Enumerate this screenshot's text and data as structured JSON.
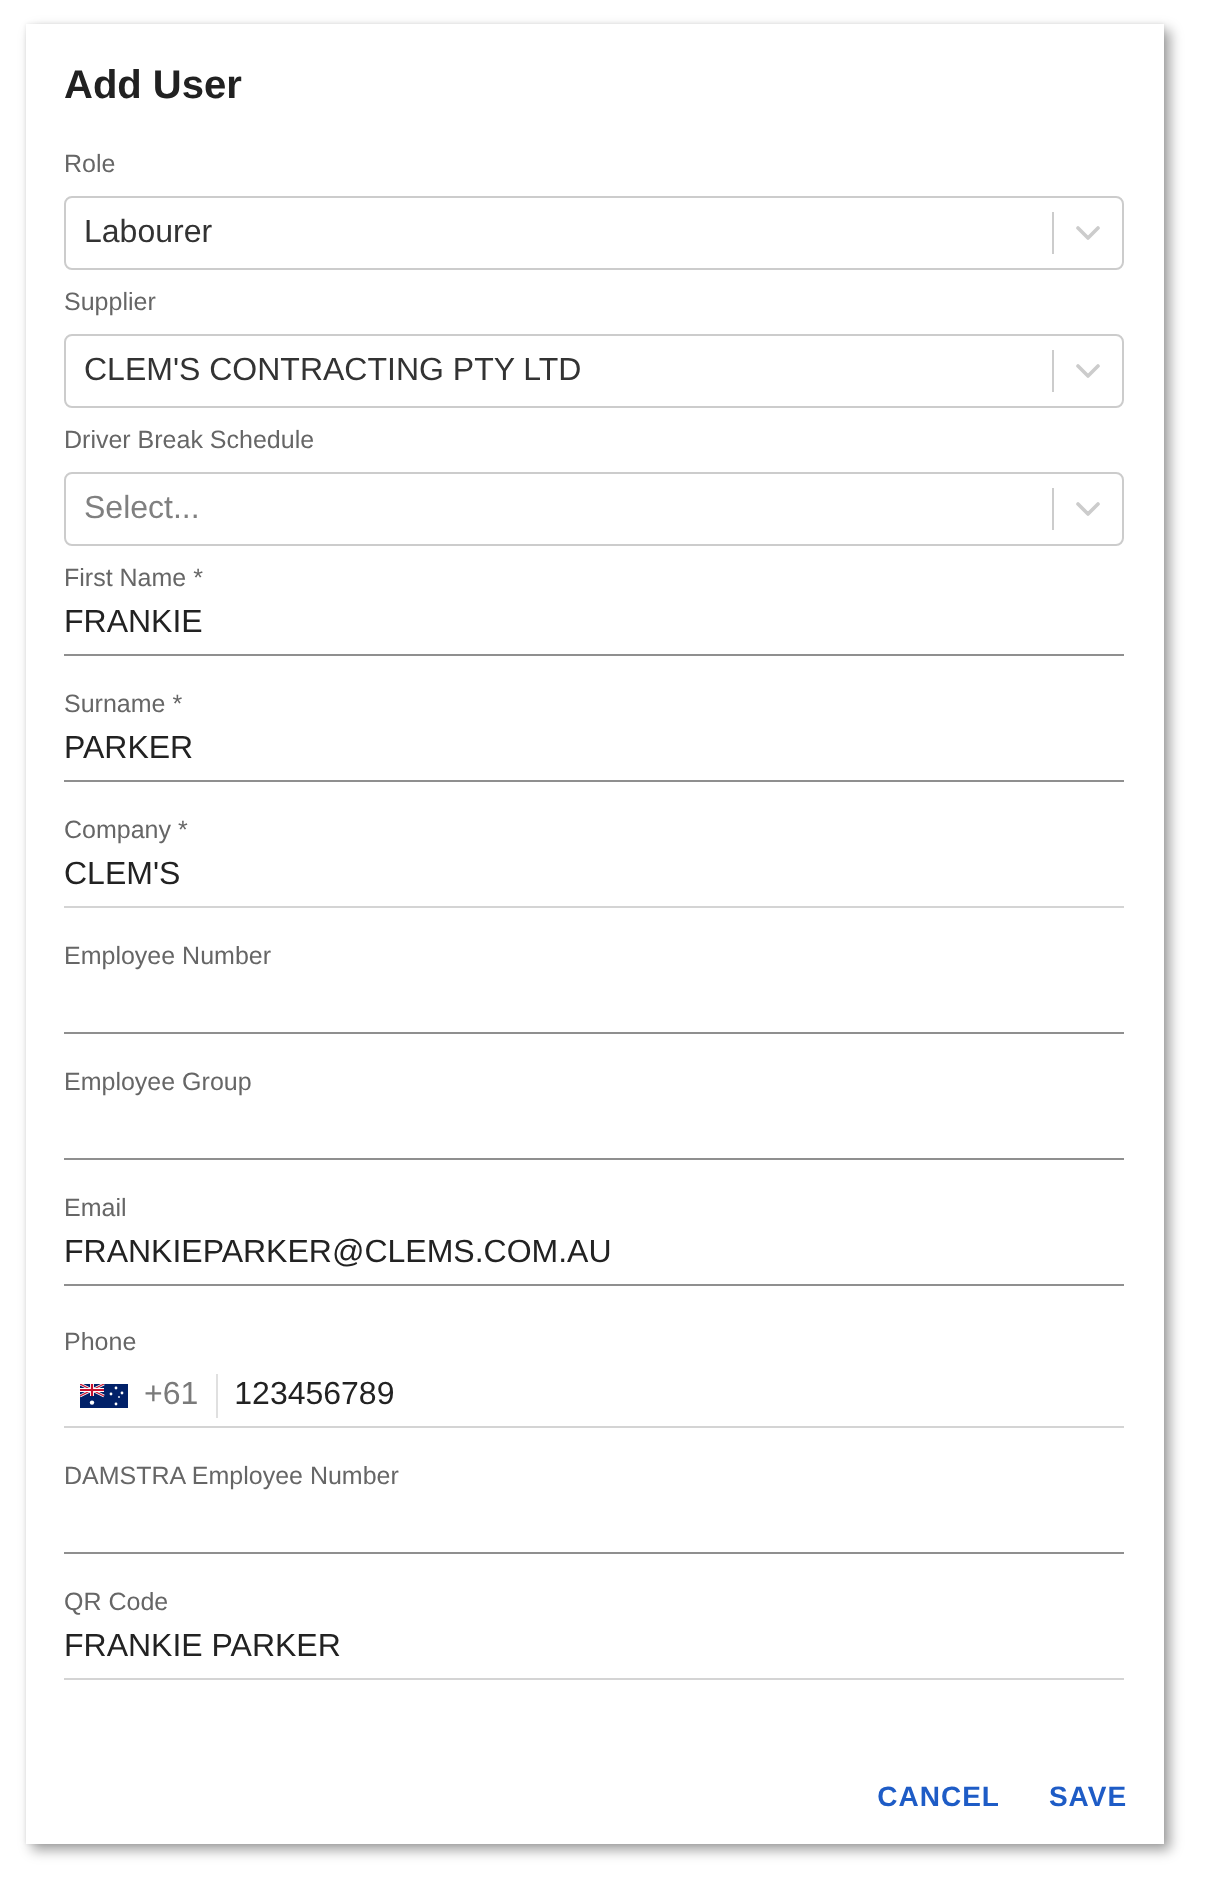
{
  "dialog": {
    "title": "Add User"
  },
  "fields": [
    {
      "kind": "select",
      "label": "Role",
      "value": "Labourer"
    },
    {
      "kind": "select",
      "label": "Supplier",
      "value": "CLEM'S CONTRACTING PTY LTD"
    },
    {
      "kind": "select",
      "label": "Driver Break Schedule",
      "placeholder": "Select..."
    },
    {
      "kind": "text",
      "label": "First Name *",
      "value": "FRANKIE",
      "read_only": false
    },
    {
      "kind": "text",
      "label": "Surname *",
      "value": "PARKER",
      "read_only": false
    },
    {
      "kind": "text",
      "label": "Company *",
      "value": "CLEM'S",
      "read_only": true
    },
    {
      "kind": "text",
      "label": "Employee Number",
      "read_only": false
    },
    {
      "kind": "text",
      "label": "Employee Group",
      "read_only": false
    },
    {
      "kind": "text",
      "label": "Email",
      "value": "FRANKIEPARKER@CLEMS.COM.AU",
      "read_only": false
    },
    {
      "kind": "phone",
      "label": "Phone",
      "country_code": "+61",
      "value": "123456789",
      "read_only": true
    },
    {
      "kind": "text",
      "label": "DAMSTRA Employee Number",
      "read_only": false
    },
    {
      "kind": "text",
      "label": "QR Code",
      "value": "FRANKIE PARKER",
      "read_only": true
    }
  ],
  "actions": [
    "CANCEL",
    "SAVE"
  ]
}
